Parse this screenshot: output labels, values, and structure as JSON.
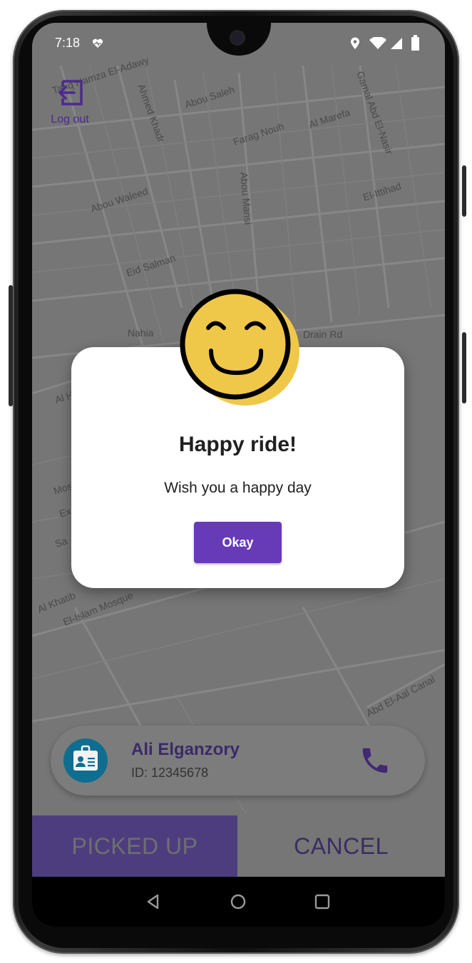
{
  "status_bar": {
    "time": "7:18",
    "icons": [
      "heart-pulse-icon",
      "location-pin-icon",
      "wifi-icon",
      "signal-icon",
      "battery-icon"
    ]
  },
  "header": {
    "logout_label": "Log out",
    "logout_icon": "logout-arrow-icon"
  },
  "map": {
    "labels": [
      "Tariq Hamza El-Adawy",
      "Ahmed Khadr",
      "Abou Saleh",
      "Gamal Abd El-Nasir",
      "Al Marefa",
      "Farag Nouh",
      "Abou Mansi",
      "El-Ittihad",
      "Abou Waleed",
      "Eid Salman",
      "Nahia",
      "Drain Rd",
      "Al H",
      "Mos",
      "Ex",
      "Sa",
      "Al Khatib",
      "El-Islam Mosque",
      "Abd El-Aal Canal"
    ]
  },
  "dialog": {
    "title": "Happy ride!",
    "message": "Wish you a happy day",
    "button_label": "Okay",
    "icon": "smiley-face-icon"
  },
  "driver_card": {
    "name": "Ali Elganzory",
    "id_text": "ID: 12345678",
    "avatar_icon": "id-badge-icon",
    "call_icon": "phone-icon"
  },
  "actions": {
    "picked_up_label": "PICKED UP",
    "cancel_label": "CANCEL"
  },
  "colors": {
    "accent": "#673ab7",
    "dark_purple": "#4b2a91",
    "smiley_yellow": "#efc84a",
    "badge_blue": "#0f6e8f"
  }
}
